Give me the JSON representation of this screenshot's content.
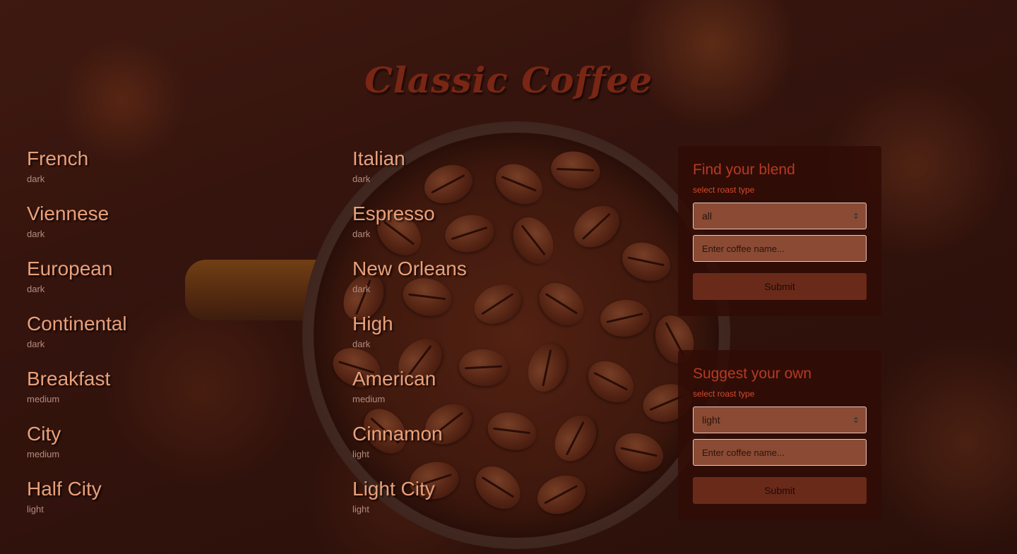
{
  "header": {
    "title": "Classic Coffee"
  },
  "coffees": {
    "column1": [
      {
        "name": "French",
        "roast": "dark"
      },
      {
        "name": "Viennese",
        "roast": "dark"
      },
      {
        "name": "European",
        "roast": "dark"
      },
      {
        "name": "Continental",
        "roast": "dark"
      },
      {
        "name": "Breakfast",
        "roast": "medium"
      },
      {
        "name": "City",
        "roast": "medium"
      },
      {
        "name": "Half City",
        "roast": "light"
      }
    ],
    "column2": [
      {
        "name": "Italian",
        "roast": "dark"
      },
      {
        "name": "Espresso",
        "roast": "dark"
      },
      {
        "name": "New Orleans",
        "roast": "dark"
      },
      {
        "name": "High",
        "roast": "dark"
      },
      {
        "name": "American",
        "roast": "medium"
      },
      {
        "name": "Cinnamon",
        "roast": "light"
      },
      {
        "name": "Light City",
        "roast": "light"
      }
    ]
  },
  "find_form": {
    "title": "Find your blend",
    "roast_label": "select roast type",
    "roast_selected": "all",
    "name_placeholder": "Enter coffee name...",
    "submit_label": "Submit"
  },
  "suggest_form": {
    "title": "Suggest your own",
    "roast_label": "select roast type",
    "roast_selected": "light",
    "name_placeholder": "Enter coffee name...",
    "submit_label": "Submit"
  },
  "colors": {
    "title": "#7a2614",
    "coffee_name": "#e9a07a",
    "panel_title": "#b53a22",
    "panel_label": "#d24a2e",
    "field_background": "#8a4a33",
    "submit_background": "#6a2a1a"
  },
  "icons": {
    "select_arrow": "select-arrows-icon"
  }
}
